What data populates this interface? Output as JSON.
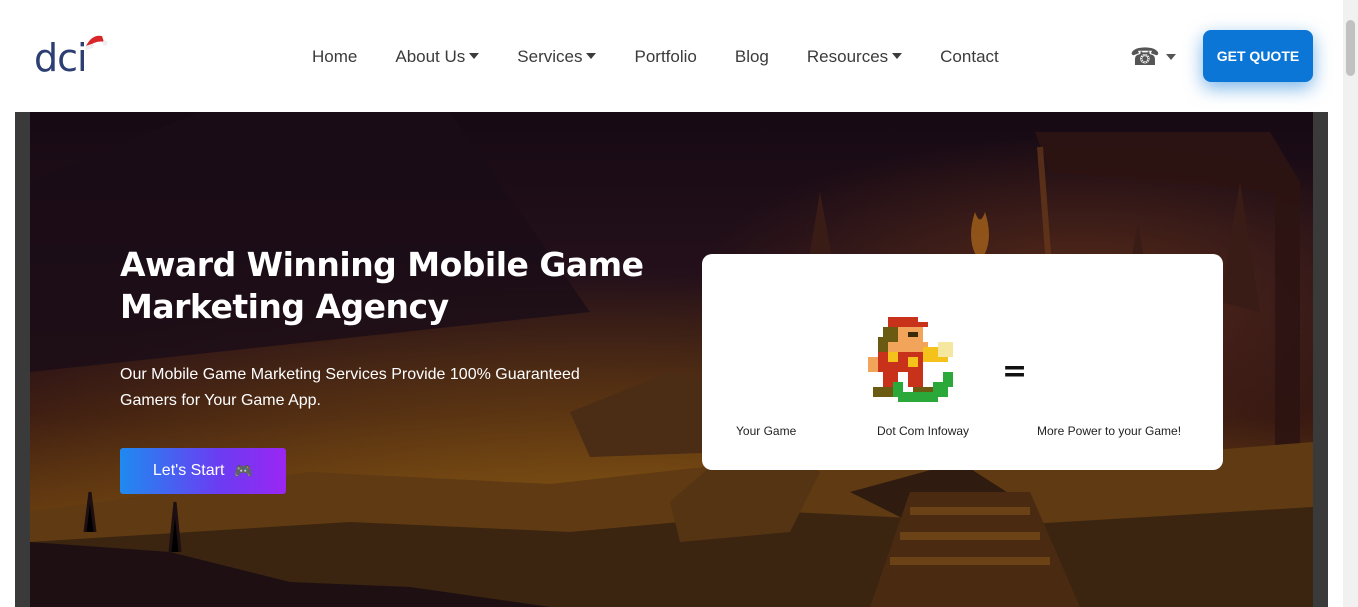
{
  "logo": {
    "text": "dci"
  },
  "nav": {
    "items": [
      {
        "label": "Home",
        "dropdown": false
      },
      {
        "label": "About Us",
        "dropdown": true
      },
      {
        "label": "Services",
        "dropdown": true
      },
      {
        "label": "Portfolio",
        "dropdown": false
      },
      {
        "label": "Blog",
        "dropdown": false
      },
      {
        "label": "Resources",
        "dropdown": true
      },
      {
        "label": "Contact",
        "dropdown": false
      }
    ],
    "phone_glyph": "☎",
    "quote_label": "GET QUOTE"
  },
  "hero": {
    "title_line1": "Award Winning Mobile Game",
    "title_line2": "Marketing Agency",
    "subtitle_line1": "Our Mobile Game Marketing Services Provide 100% Guaranteed",
    "subtitle_line2": "Gamers for Your Game App.",
    "cta_label": "Let's Start",
    "cta_icon": "🎮"
  },
  "card": {
    "equals": "=",
    "captions": [
      "Your Game",
      "Dot Com Infoway",
      "More Power to your Game!"
    ]
  },
  "colors": {
    "brand_blue": "#0b76d6",
    "logo_navy": "#2c3e72",
    "cta_gradient_start": "#1f8af0",
    "cta_gradient_end": "#9a26f2"
  },
  "icons": [
    "santa-hat-icon",
    "caret-down-icon",
    "phone-icon",
    "gamepad-icon",
    "pixel-mario-icon"
  ]
}
